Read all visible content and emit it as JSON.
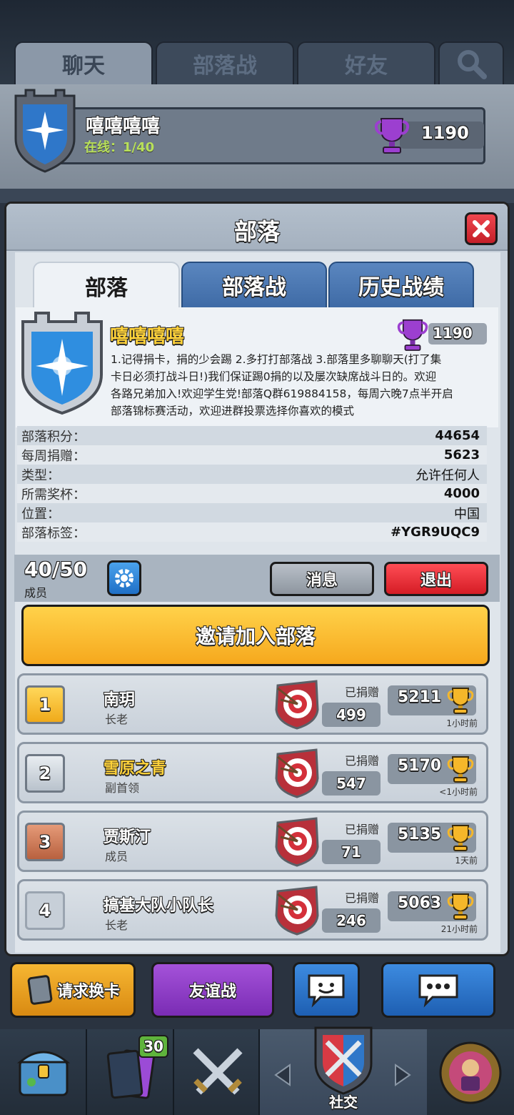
{
  "top_tabs": [
    {
      "label": "聊天"
    },
    {
      "label": "部落战"
    },
    {
      "label": "好友"
    }
  ],
  "clan_header": {
    "name": "嘻嘻嘻嘻",
    "online": "在线：1/40",
    "trophies": "1190"
  },
  "modal": {
    "title": "部落",
    "tabs": [
      {
        "label": "部落"
      },
      {
        "label": "部落战"
      },
      {
        "label": "历史战绩"
      }
    ],
    "clan_name": "嘻嘻嘻嘻",
    "clan_trophies": "1190",
    "description_lines": [
      "1.记得捐卡，捐的少会踢 2.多打打部落战 3.部落里多聊聊天(打了集",
      "卡日必须打战斗日!)我们保证踢0捐的以及屡次缺席战斗日的。欢迎",
      "各路兄弟加入!欢迎学生党!部落Q群619884158，每周六晚7点半开启",
      "部落锦标赛活动，欢迎进群投票选择你喜欢的模式"
    ],
    "info": [
      {
        "label": "部落积分：",
        "value": "44654"
      },
      {
        "label": "每周捐赠：",
        "value": "5623"
      },
      {
        "label": "类型：",
        "value": "允许任何人"
      },
      {
        "label": "所需奖杯：",
        "value": "4000"
      },
      {
        "label": "位置：",
        "value": "中国"
      },
      {
        "label": "部落标签：",
        "value": "#YGR9UQC9"
      }
    ],
    "member_count": "40/50",
    "member_label": "成员",
    "message_button": "消息",
    "leave_button": "退出",
    "invite_button": "邀请加入部落",
    "donated_label": "已捐赠",
    "members": [
      {
        "rank": "1",
        "name": "南玥",
        "role": "长老",
        "donated": "499",
        "trophies": "5211",
        "last_seen": "1小时前"
      },
      {
        "rank": "2",
        "name": "雪原之青",
        "role": "副首领",
        "donated": "547",
        "trophies": "5170",
        "last_seen": "<1小时前"
      },
      {
        "rank": "3",
        "name": "贾斯汀",
        "role": "成员",
        "donated": "71",
        "trophies": "5135",
        "last_seen": "1天前"
      },
      {
        "rank": "4",
        "name": "搞基大队小队长",
        "role": "长老",
        "donated": "246",
        "trophies": "5063",
        "last_seen": "21小时前"
      }
    ]
  },
  "bottom_buttons": {
    "request": "请求换卡",
    "friendly": "友谊战"
  },
  "navbar": {
    "card_badge": "30",
    "social_label": "社交"
  },
  "colors": {
    "gold": "#f6b32a",
    "red": "#e8323a",
    "purple": "#8e3bc6",
    "blue": "#2e73c6"
  }
}
